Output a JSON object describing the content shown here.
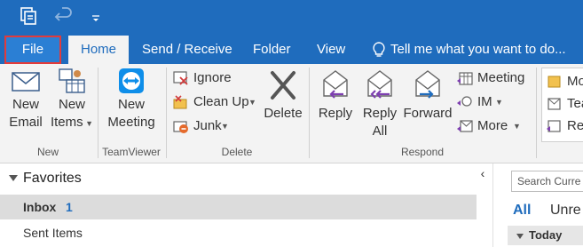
{
  "quick_access": {
    "send_receive_icon": "send-receive-all-folders-icon",
    "undo_icon": "undo-icon",
    "customize_icon": "customize-toolbar-icon"
  },
  "tabs": [
    {
      "label": "File"
    },
    {
      "label": "Home"
    },
    {
      "label": "Send / Receive"
    },
    {
      "label": "Folder"
    },
    {
      "label": "View"
    }
  ],
  "tell_me": {
    "text": "Tell me what you want to do..."
  },
  "ribbon": {
    "new_email": "New\nEmail",
    "new_email_line1": "New",
    "new_email_line2": "Email",
    "new_items_line1": "New",
    "new_items_line2": "Items",
    "new_group": "New",
    "new_meeting_line1": "New",
    "new_meeting_line2": "Meeting",
    "teamviewer_group": "TeamViewer",
    "ignore": "Ignore",
    "clean_up": "Clean Up",
    "junk": "Junk",
    "delete": "Delete",
    "delete_group": "Delete",
    "reply": "Reply",
    "reply_all_line1": "Reply",
    "reply_all_line2": "All",
    "forward": "Forward",
    "meeting": "Meeting",
    "im": "IM",
    "more": "More",
    "respond_group": "Respond",
    "quicksteps": [
      "Mo",
      "Tea",
      "Rep"
    ]
  },
  "nav": {
    "favorites": "Favorites",
    "folders": [
      {
        "name": "Inbox",
        "count": "1"
      },
      {
        "name": "Sent Items",
        "count": ""
      }
    ]
  },
  "mail_list": {
    "search_placeholder": "Search Curre",
    "filter_all": "All",
    "filter_unread": "Unre",
    "group_today": "Today"
  },
  "colors": {
    "accent": "#1f6cbd",
    "file_highlight": "#e23b3b"
  }
}
